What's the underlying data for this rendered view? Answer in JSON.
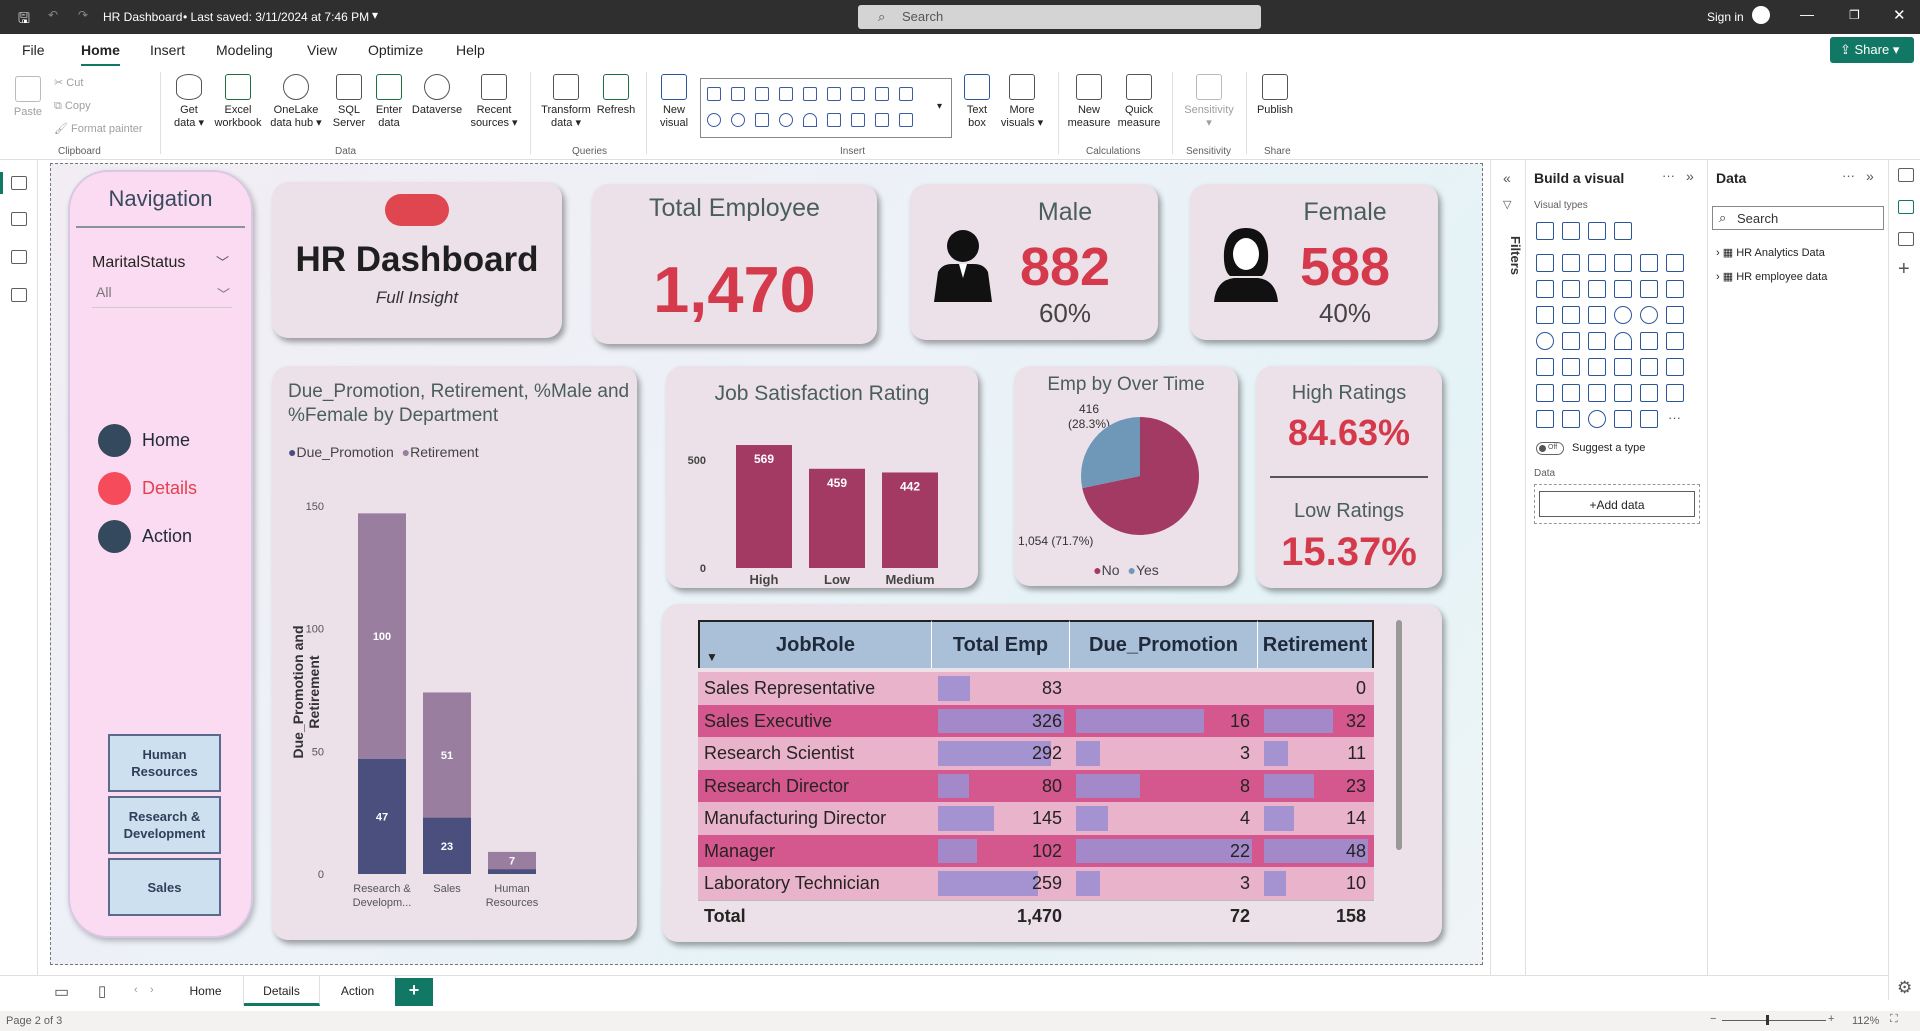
{
  "titlebar": {
    "title": "HR Dashboard",
    "saved": "• Last saved: 3/11/2024 at 7:46 PM",
    "search_placeholder": "Search",
    "signin": "Sign in"
  },
  "menu": {
    "items": [
      "File",
      "Home",
      "Insert",
      "Modeling",
      "View",
      "Optimize",
      "Help"
    ],
    "share": "Share"
  },
  "ribbon": {
    "clipboard": {
      "paste": "Paste",
      "cut": "Cut",
      "copy": "Copy",
      "format_painter": "Format painter",
      "label": "Clipboard"
    },
    "data": {
      "get_data": [
        "Get",
        "data"
      ],
      "excel": [
        "Excel",
        "workbook"
      ],
      "onelake": [
        "OneLake",
        "data hub"
      ],
      "sql": [
        "SQL",
        "Server"
      ],
      "enter": [
        "Enter",
        "data"
      ],
      "dataverse": "Dataverse",
      "recent": [
        "Recent",
        "sources"
      ],
      "label": "Data"
    },
    "queries": {
      "transform": [
        "Transform",
        "data"
      ],
      "refresh": "Refresh",
      "label": "Queries"
    },
    "insert": {
      "new_visual": [
        "New",
        "visual"
      ],
      "text_box": [
        "Text",
        "box"
      ],
      "more_visuals": [
        "More",
        "visuals"
      ],
      "label": "Insert"
    },
    "calculations": {
      "new_measure": [
        "New",
        "measure"
      ],
      "quick_measure": [
        "Quick",
        "measure"
      ],
      "label": "Calculations"
    },
    "sensitivity": {
      "btn": "Sensitivity",
      "label": "Sensitivity"
    },
    "share": {
      "publish": "Publish",
      "label": "Share"
    }
  },
  "nav": {
    "title": "Navigation",
    "slicer_title": "MaritalStatus",
    "slicer_value": "All",
    "items": [
      {
        "label": "Home",
        "color": "#34495e"
      },
      {
        "label": "Details",
        "color": "#f54b5b"
      },
      {
        "label": "Action",
        "color": "#34495e"
      }
    ],
    "dept_buttons": [
      "Human Resources",
      "Research & Development",
      "Sales"
    ]
  },
  "header": {
    "title": "HR Dashboard",
    "subtitle": "Full Insight"
  },
  "kpis": {
    "total": {
      "title": "Total Employee",
      "value": "1,470"
    },
    "male": {
      "title": "Male",
      "value": "882",
      "pct": "60%"
    },
    "female": {
      "title": "Female",
      "value": "588",
      "pct": "40%"
    },
    "high": {
      "title": "High Ratings",
      "value": "84.63%"
    },
    "low": {
      "title": "Low Ratings",
      "value": "15.37%"
    }
  },
  "dept_chart": {
    "title": "Due_Promotion, Retirement, %Male and %Female by Department",
    "legend": [
      "Due_Promotion",
      "Retirement"
    ],
    "ylabel": "Due_Promotion and Retirement",
    "yticks": [
      "150",
      "100",
      "50",
      "0"
    ],
    "xlabels": [
      "Research & Developm...",
      "Sales",
      "Human Resources"
    ]
  },
  "satisfaction_chart": {
    "title": "Job Satisfaction Rating",
    "yticks": [
      "500",
      "0"
    ]
  },
  "overtime_chart": {
    "title": "Emp by Over Time",
    "label_yes": "416",
    "label_yes_pct": "(28.3%)",
    "label_no": "1,054 (71.7%)",
    "legend": [
      "No",
      "Yes"
    ]
  },
  "chart_data": [
    {
      "type": "bar",
      "title": "Due_Promotion, Retirement, %Male and %Female by Department",
      "categories": [
        "Research & Development",
        "Sales",
        "Human Resources"
      ],
      "series": [
        {
          "name": "Due_Promotion",
          "values": [
            47,
            23,
            2
          ],
          "color": "#4a4f7e"
        },
        {
          "name": "Retirement",
          "values": [
            100,
            51,
            7
          ],
          "color": "#9a7ea0"
        }
      ],
      "stacked": true,
      "ylabel": "Due_Promotion and Retirement",
      "ylim": [
        0,
        150
      ]
    },
    {
      "type": "bar",
      "title": "Job Satisfaction Rating",
      "categories": [
        "High",
        "Low",
        "Medium"
      ],
      "values": [
        569,
        459,
        442
      ],
      "color": "#a33a63",
      "ylim": [
        0,
        620
      ]
    },
    {
      "type": "pie",
      "title": "Emp by Over Time",
      "categories": [
        "No",
        "Yes"
      ],
      "values": [
        1054,
        416
      ],
      "colors": [
        "#a33a63",
        "#6e97b8"
      ]
    },
    {
      "type": "table",
      "columns": [
        "JobRole",
        "Total Emp",
        "Due_Promotion",
        "Retirement"
      ],
      "rows": [
        [
          "Sales Representative",
          83,
          null,
          0
        ],
        [
          "Sales Executive",
          326,
          16,
          32
        ],
        [
          "Research Scientist",
          292,
          3,
          11
        ],
        [
          "Research Director",
          80,
          8,
          23
        ],
        [
          "Manufacturing Director",
          145,
          4,
          14
        ],
        [
          "Manager",
          102,
          22,
          48
        ],
        [
          "Laboratory Technician",
          259,
          3,
          10
        ]
      ],
      "total": [
        "Total",
        "1,470",
        "72",
        "158"
      ]
    }
  ],
  "build_pane": {
    "title": "Build a visual",
    "visual_types": "Visual types",
    "suggest": "Suggest a type",
    "off": "Off",
    "data": "Data",
    "add_data": "+Add data"
  },
  "filters_label": "Filters",
  "data_pane": {
    "title": "Data",
    "search": "Search",
    "tables": [
      "HR Analytics Data",
      "HR employee data"
    ]
  },
  "page_tabs": [
    "Home",
    "Details",
    "Action"
  ],
  "status": {
    "page": "Page 2 of 3",
    "zoom": "112%"
  }
}
